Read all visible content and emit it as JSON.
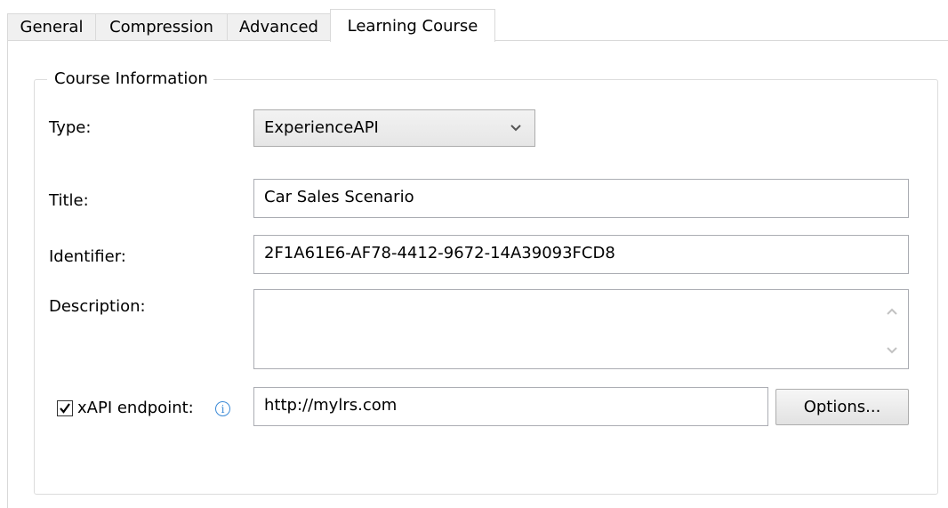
{
  "tabs": [
    {
      "label": "General"
    },
    {
      "label": "Compression"
    },
    {
      "label": "Advanced"
    },
    {
      "label": "Learning Course",
      "active": true
    }
  ],
  "group": {
    "title": "Course Information"
  },
  "type": {
    "label": "Type:",
    "value": "ExperienceAPI",
    "icon": "chevron-down-icon"
  },
  "title": {
    "label": "Title:",
    "value": "Car Sales Scenario"
  },
  "identifier": {
    "label": "Identifier:",
    "value": "2F1A61E6-AF78-4412-9672-14A39093FCD8"
  },
  "description": {
    "label": "Description:",
    "value": ""
  },
  "xapi": {
    "checked": true,
    "label": "xAPI endpoint:",
    "value": "http://mylrs.com",
    "options_label": "Options...",
    "info_icon": "info-icon"
  },
  "colors": {
    "info": "#3b8ad6",
    "border": "#d9d9d9"
  }
}
